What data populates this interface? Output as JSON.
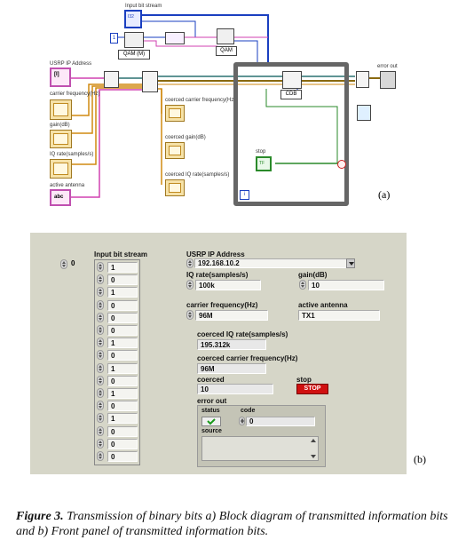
{
  "block_diagram": {
    "labels": {
      "input_bit_stream": "Input bit stream",
      "usrp_ip": "USRP IP Address",
      "carrier_freq": "carrier frequency(Hz)",
      "gain": "gain(dB)",
      "iq_rate": "IQ rate(samples/s)",
      "active_antenna": "active antenna",
      "coerced_carrier": "coerced carrier frequency(Hz)",
      "coerced_gain": "coerced gain(dB)",
      "coerced_iq": "coerced IQ rate(samples/s)",
      "error_out": "error out",
      "stop": "stop",
      "qam_m": "QAM (M)",
      "qam": "QAM",
      "cdb": "CDB",
      "ip_const": "[I]",
      "ant_const": "abc",
      "terminal_i32": "I32",
      "terminal_dbl": "DBL",
      "terminal_tf": "TF",
      "loop_iter": "i"
    },
    "caption_letter": "(a)"
  },
  "front_panel": {
    "input_bit_stream_label": "Input bit stream",
    "index_value": "0",
    "bits": [
      "1",
      "0",
      "1",
      "0",
      "0",
      "0",
      "1",
      "0",
      "1",
      "0",
      "1",
      "0",
      "1",
      "0",
      "0",
      "0"
    ],
    "usrp_ip_label": "USRP IP Address",
    "usrp_ip_value": "192.168.10.2",
    "iq_rate_label": "IQ rate(samples/s)",
    "iq_rate_value": "100k",
    "gain_label": "gain(dB)",
    "gain_value": "10",
    "carrier_label": "carrier frequency(Hz)",
    "carrier_value": "96M",
    "antenna_label": "active antenna",
    "antenna_value": "TX1",
    "coerced_iq_label": "coerced IQ rate(samples/s)",
    "coerced_iq_value": "195.312k",
    "coerced_carrier_label": "coerced carrier frequency(Hz)",
    "coerced_carrier_value": "96M",
    "coerced_label": "coerced",
    "coerced_value": "10",
    "stop_label": "stop",
    "stop_button": "STOP",
    "error_out_label": "error out",
    "status_label": "status",
    "code_label": "code",
    "code_value": "0",
    "source_label": "source",
    "caption_letter": "(b)"
  },
  "caption": {
    "figure_label": "Figure 3.",
    "text": " Transmission of binary bits a) Block diagram of transmitted information bits and b) Front panel of transmitted information bits."
  },
  "colors": {
    "wire_blue": "#1a3fc0",
    "wire_orange": "#d08a10",
    "wire_pink": "#d040b0",
    "wire_green": "#2a8a2a",
    "wire_error": "#8a6a10",
    "panel_bg": "#d6d6c8",
    "stop_red": "#d01010"
  }
}
